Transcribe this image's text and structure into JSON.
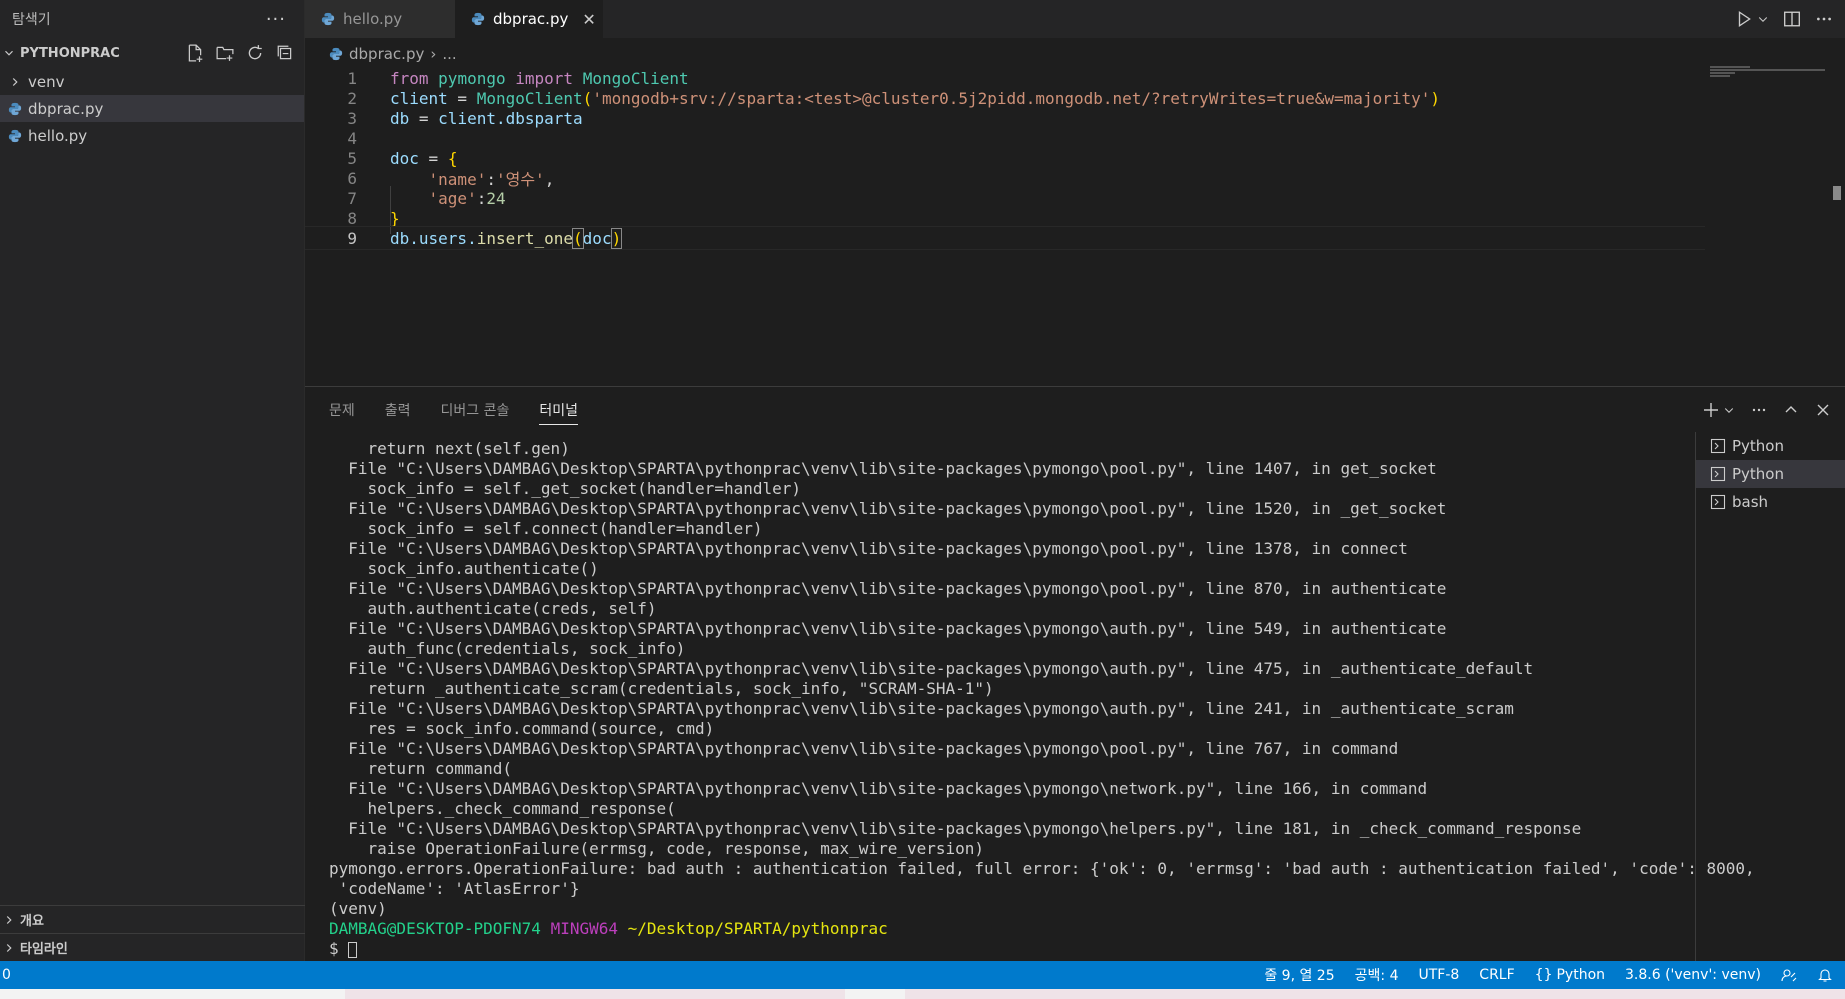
{
  "sidebar": {
    "title": "탐색기",
    "more": "···",
    "project": "PYTHONPRAC",
    "items": [
      {
        "label": "venv",
        "type": "folder"
      },
      {
        "label": "dbprac.py",
        "type": "python",
        "selected": true
      },
      {
        "label": "hello.py",
        "type": "python"
      }
    ],
    "outline": "개요",
    "timeline": "타임라인"
  },
  "tabs": [
    {
      "label": "hello.py",
      "active": false
    },
    {
      "label": "dbprac.py",
      "active": true
    }
  ],
  "breadcrumb": {
    "file": "dbprac.py",
    "rest": "..."
  },
  "editor": {
    "line_numbers": [
      "1",
      "2",
      "3",
      "4",
      "5",
      "6",
      "7",
      "8",
      "9"
    ],
    "active_line": "9",
    "lines": {
      "l1": {
        "kw1": "from",
        "mod": "pymongo",
        "kw2": "import",
        "cls": "MongoClient"
      },
      "l2": {
        "var": "client",
        "eq": " = ",
        "cls": "MongoClient",
        "open": "(",
        "str": "'mongodb+srv://sparta:<test>@cluster0.5j2pidd.mongodb.net/?retryWrites=true&w=majority'",
        "close": ")"
      },
      "l3": {
        "var": "db",
        "eq": " = ",
        "obj": "client",
        "attr": ".dbsparta"
      },
      "l5": {
        "var": "doc",
        "eq": " = ",
        "brace": "{"
      },
      "l6": {
        "key": "'name'",
        "colon": ":",
        "val": "'영수'",
        "comma": ","
      },
      "l7": {
        "key": "'age'",
        "colon": ":",
        "val": "24"
      },
      "l8": {
        "brace": "}"
      },
      "l9": {
        "obj": "db",
        "attr": ".users.",
        "fn": "insert_one",
        "open": "(",
        "arg": "doc",
        "close": ")"
      }
    }
  },
  "panel": {
    "tabs": [
      "문제",
      "출력",
      "디버그 콘솔",
      "터미널"
    ],
    "active_tab": "터미널",
    "terminal_lines": [
      "    return next(self.gen)",
      "  File \"C:\\Users\\DAMBAG\\Desktop\\SPARTA\\pythonprac\\venv\\lib\\site-packages\\pymongo\\pool.py\", line 1407, in get_socket",
      "    sock_info = self._get_socket(handler=handler)",
      "  File \"C:\\Users\\DAMBAG\\Desktop\\SPARTA\\pythonprac\\venv\\lib\\site-packages\\pymongo\\pool.py\", line 1520, in _get_socket",
      "    sock_info = self.connect(handler=handler)",
      "  File \"C:\\Users\\DAMBAG\\Desktop\\SPARTA\\pythonprac\\venv\\lib\\site-packages\\pymongo\\pool.py\", line 1378, in connect",
      "    sock_info.authenticate()",
      "  File \"C:\\Users\\DAMBAG\\Desktop\\SPARTA\\pythonprac\\venv\\lib\\site-packages\\pymongo\\pool.py\", line 870, in authenticate",
      "    auth.authenticate(creds, self)",
      "  File \"C:\\Users\\DAMBAG\\Desktop\\SPARTA\\pythonprac\\venv\\lib\\site-packages\\pymongo\\auth.py\", line 549, in authenticate",
      "    auth_func(credentials, sock_info)",
      "  File \"C:\\Users\\DAMBAG\\Desktop\\SPARTA\\pythonprac\\venv\\lib\\site-packages\\pymongo\\auth.py\", line 475, in _authenticate_default",
      "    return _authenticate_scram(credentials, sock_info, \"SCRAM-SHA-1\")",
      "  File \"C:\\Users\\DAMBAG\\Desktop\\SPARTA\\pythonprac\\venv\\lib\\site-packages\\pymongo\\auth.py\", line 241, in _authenticate_scram",
      "    res = sock_info.command(source, cmd)",
      "  File \"C:\\Users\\DAMBAG\\Desktop\\SPARTA\\pythonprac\\venv\\lib\\site-packages\\pymongo\\pool.py\", line 767, in command",
      "    return command(",
      "  File \"C:\\Users\\DAMBAG\\Desktop\\SPARTA\\pythonprac\\venv\\lib\\site-packages\\pymongo\\network.py\", line 166, in command",
      "    helpers._check_command_response(",
      "  File \"C:\\Users\\DAMBAG\\Desktop\\SPARTA\\pythonprac\\venv\\lib\\site-packages\\pymongo\\helpers.py\", line 181, in _check_command_response",
      "    raise OperationFailure(errmsg, code, response, max_wire_version)",
      "pymongo.errors.OperationFailure: bad auth : authentication failed, full error: {'ok': 0, 'errmsg': 'bad auth : authentication failed', 'code': 8000,",
      " 'codeName': 'AtlasError'}",
      "(venv)"
    ],
    "prompt": {
      "user": "DAMBAG@DESKTOP-PDOFN74",
      "shell": "MINGW64",
      "path": "~/Desktop/SPARTA/pythonprac",
      "dollar": "$ "
    },
    "terminals": [
      {
        "label": "Python",
        "selected": false
      },
      {
        "label": "Python",
        "selected": true
      },
      {
        "label": "bash",
        "selected": false
      }
    ]
  },
  "statusbar": {
    "left": "0",
    "position": "줄 9, 열 25",
    "spaces": "공백: 4",
    "encoding": "UTF-8",
    "eol": "CRLF",
    "language": "Python",
    "interpreter": "3.8.6 ('venv': venv)"
  },
  "colors": {
    "accent": "#007acc",
    "background": "#1e1e1e",
    "sidebar": "#252526"
  }
}
